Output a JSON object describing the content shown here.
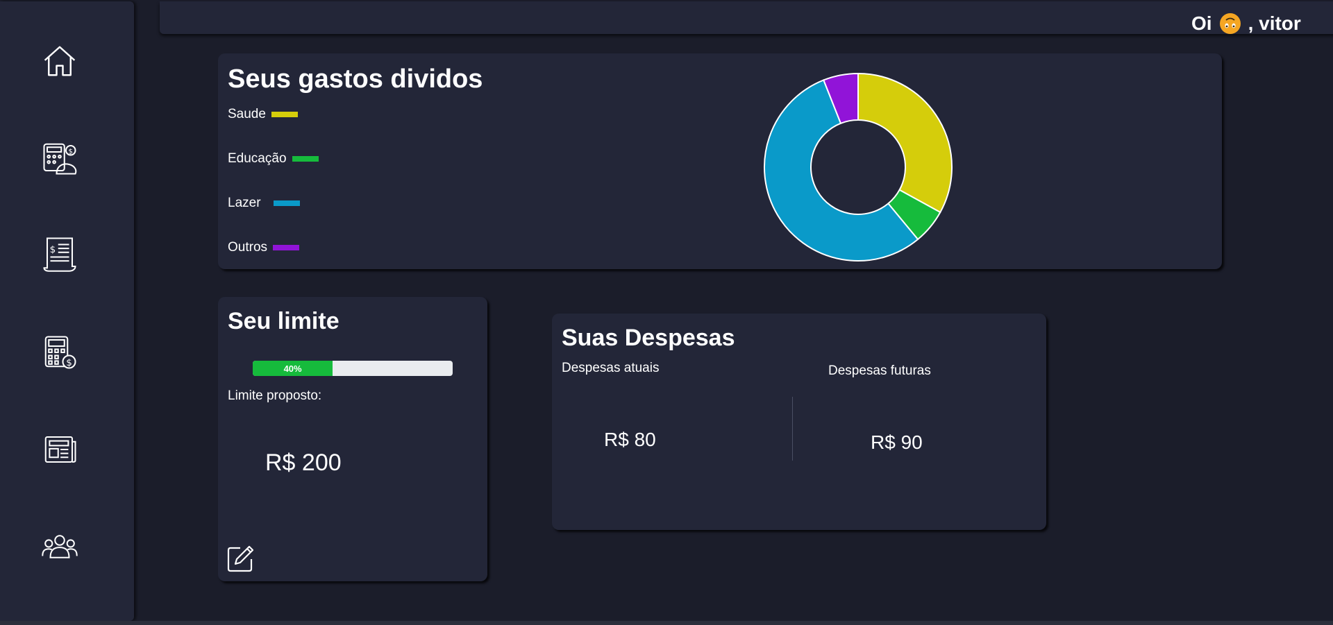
{
  "header": {
    "greeting_prefix": "Oi",
    "greeting_emoji": "upside-down-face-emoji",
    "greeting_name": ", vitor"
  },
  "sidebar": {
    "items": [
      {
        "icon": "home-icon"
      },
      {
        "icon": "calculator-money-icon"
      },
      {
        "icon": "invoice-receipt-icon"
      },
      {
        "icon": "calculator-coin-icon"
      },
      {
        "icon": "newspaper-icon"
      },
      {
        "icon": "users-group-icon"
      }
    ]
  },
  "gastos": {
    "title": "Seus gastos dividos",
    "legend": [
      {
        "label": "Saude",
        "color": "#d5cd0b"
      },
      {
        "label": "Educação",
        "color": "#16bb3c"
      },
      {
        "label": "Lazer",
        "color": "#0a9ac9"
      },
      {
        "label": "Outros",
        "color": "#9114d8"
      }
    ]
  },
  "chart_data": {
    "type": "pie",
    "categories": [
      "Saude",
      "Educação",
      "Lazer",
      "Outros"
    ],
    "values": [
      33,
      6,
      55,
      6
    ],
    "colors": [
      "#d5cd0b",
      "#16bb3c",
      "#0a9ac9",
      "#9114d8"
    ],
    "donut": true,
    "legend": "left"
  },
  "limite": {
    "title": "Seu limite",
    "progress": 0.4,
    "progress_label": "40%",
    "proposto_label": "Limite proposto:",
    "proposto_value": "R$ 200",
    "edit_icon": "edit-icon"
  },
  "despesas": {
    "title": "Suas Despesas",
    "atuais_label": "Despesas atuais",
    "atuais_value": "R$ 80",
    "futuras_label": "Despesas futuras",
    "futuras_value": "R$ 90"
  }
}
